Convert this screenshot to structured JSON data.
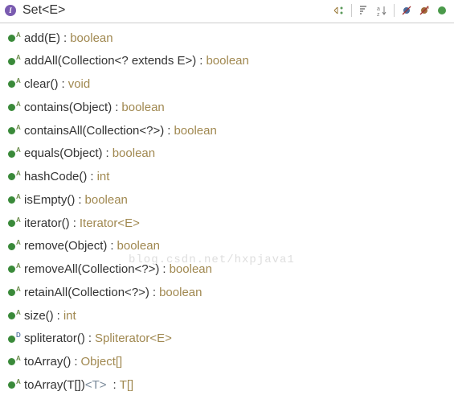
{
  "header": {
    "title": "Set<E>",
    "interface_glyph": "I"
  },
  "members": [
    {
      "kind": "abstract",
      "signature": "add(E)",
      "returnType": "boolean"
    },
    {
      "kind": "abstract",
      "signature": "addAll(Collection<? extends E>)",
      "returnType": "boolean"
    },
    {
      "kind": "abstract",
      "signature": "clear()",
      "returnType": "void"
    },
    {
      "kind": "abstract",
      "signature": "contains(Object)",
      "returnType": "boolean"
    },
    {
      "kind": "abstract",
      "signature": "containsAll(Collection<?>)",
      "returnType": "boolean"
    },
    {
      "kind": "abstract",
      "signature": "equals(Object)",
      "returnType": "boolean"
    },
    {
      "kind": "abstract",
      "signature": "hashCode()",
      "returnType": "int"
    },
    {
      "kind": "abstract",
      "signature": "isEmpty()",
      "returnType": "boolean"
    },
    {
      "kind": "abstract",
      "signature": "iterator()",
      "returnType": "Iterator<E>"
    },
    {
      "kind": "abstract",
      "signature": "remove(Object)",
      "returnType": "boolean"
    },
    {
      "kind": "abstract",
      "signature": "removeAll(Collection<?>)",
      "returnType": "boolean"
    },
    {
      "kind": "abstract",
      "signature": "retainAll(Collection<?>)",
      "returnType": "boolean"
    },
    {
      "kind": "abstract",
      "signature": "size()",
      "returnType": "int"
    },
    {
      "kind": "default",
      "signature": "spliterator()",
      "returnType": "Spliterator<E>"
    },
    {
      "kind": "abstract",
      "signature": "toArray()",
      "returnType": "Object[]"
    },
    {
      "kind": "abstract",
      "signature": "toArray(T[])",
      "typeParam": "<T>",
      "returnType": "T[]"
    }
  ],
  "watermark": "blog.csdn.net/hxpjava1",
  "badges": {
    "abstract": "A",
    "default": "D"
  }
}
